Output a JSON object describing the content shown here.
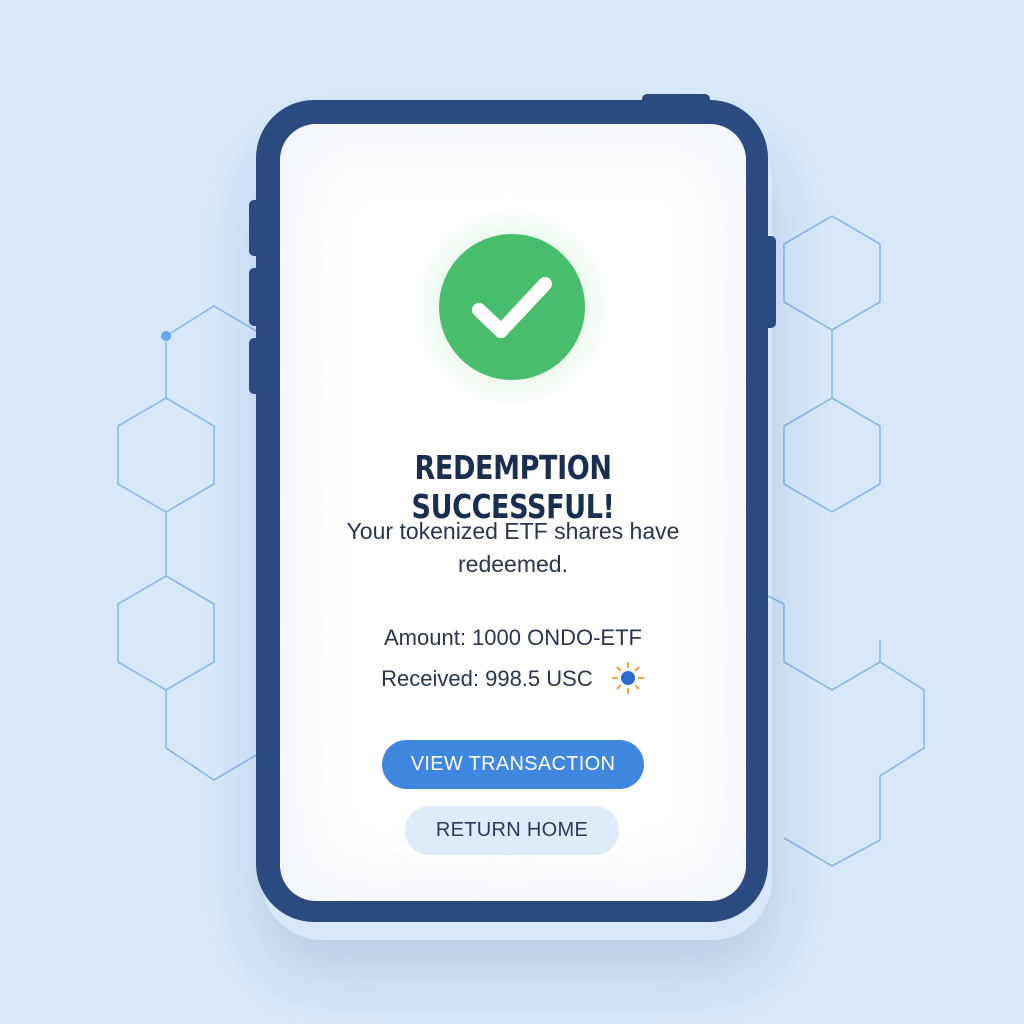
{
  "icons": {
    "success": "check-circle-icon",
    "received_currency": "sun-icon"
  },
  "colors": {
    "background": "#d6e8fa",
    "phone_frame": "#2b4a80",
    "success_green": "#48bd6c",
    "primary_button": "#3f87df",
    "secondary_button": "#dfebfa"
  },
  "screen": {
    "title": "REDEMPTION SUCCESSFUL!",
    "subtitle_line1": "Your tokenized ETF shares have",
    "subtitle_line2": "redeemed.",
    "amount": "Amount: 1000 ONDO-ETF",
    "received": "Received: 998.5 USC"
  },
  "actions": {
    "view_transaction": "VIEW TRANSACTION",
    "return_home": "RETURN HOME"
  }
}
